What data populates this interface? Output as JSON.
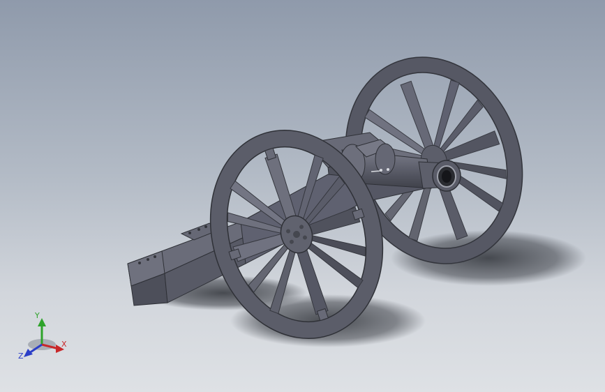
{
  "viewport": {
    "background_top": "#8f9aab",
    "background_bottom": "#dee1e5"
  },
  "model": {
    "name": "field-cannon",
    "body_color": "#5d5f6c",
    "shadow_color": "#3e4148"
  },
  "triad": {
    "x_label": "X",
    "y_label": "Y",
    "z_label": "Z",
    "x_color": "#c8282a",
    "y_color": "#2ea32b",
    "z_color": "#2b3ec7"
  }
}
